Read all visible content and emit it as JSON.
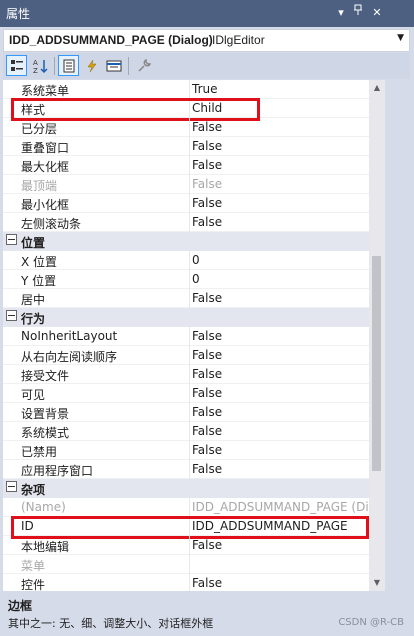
{
  "window": {
    "title": "属性"
  },
  "object_selector": {
    "name": "IDD_ADDSUMMAND_PAGE (Dialog)",
    "type": "IDlgEditor"
  },
  "toolbar": {
    "buttons": [
      "categorized-icon",
      "alphabetical-icon",
      "properties-icon",
      "events-icon",
      "messages-icon",
      "property-pages-icon"
    ]
  },
  "rows": [
    {
      "kind": "prop",
      "label": "系统菜单",
      "value": "True"
    },
    {
      "kind": "prop",
      "label": "样式",
      "value": "Child"
    },
    {
      "kind": "prop",
      "label": "已分层",
      "value": "False"
    },
    {
      "kind": "prop",
      "label": "重叠窗口",
      "value": "False"
    },
    {
      "kind": "prop",
      "label": "最大化框",
      "value": "False"
    },
    {
      "kind": "prop",
      "label": "最顶端",
      "value": "False",
      "disabled": true
    },
    {
      "kind": "prop",
      "label": "最小化框",
      "value": "False"
    },
    {
      "kind": "prop",
      "label": "左侧滚动条",
      "value": "False"
    },
    {
      "kind": "cat",
      "label": "位置"
    },
    {
      "kind": "prop",
      "label": "X 位置",
      "value": "0"
    },
    {
      "kind": "prop",
      "label": "Y 位置",
      "value": "0"
    },
    {
      "kind": "prop",
      "label": "居中",
      "value": "False"
    },
    {
      "kind": "cat",
      "label": "行为"
    },
    {
      "kind": "prop",
      "label": "NoInheritLayout",
      "value": "False"
    },
    {
      "kind": "prop",
      "label": "从右向左阅读顺序",
      "value": "False"
    },
    {
      "kind": "prop",
      "label": "接受文件",
      "value": "False"
    },
    {
      "kind": "prop",
      "label": "可见",
      "value": "False"
    },
    {
      "kind": "prop",
      "label": "设置背景",
      "value": "False"
    },
    {
      "kind": "prop",
      "label": "系统模式",
      "value": "False"
    },
    {
      "kind": "prop",
      "label": "已禁用",
      "value": "False"
    },
    {
      "kind": "prop",
      "label": "应用程序窗口",
      "value": "False"
    },
    {
      "kind": "cat",
      "label": "杂项"
    },
    {
      "kind": "prop",
      "label": "(Name)",
      "value": "IDD_ADDSUMMAND_PAGE (Di",
      "disabled": true
    },
    {
      "kind": "prop",
      "label": "ID",
      "value": "IDD_ADDSUMMAND_PAGE"
    },
    {
      "kind": "prop",
      "label": "本地编辑",
      "value": "False"
    },
    {
      "kind": "prop",
      "label": "菜单",
      "value": "",
      "disabled": true
    },
    {
      "kind": "prop",
      "label": "控件",
      "value": "False"
    }
  ],
  "description": {
    "title": "边框",
    "text": "其中之一: 无、细、调整大小、对话框外框"
  },
  "watermark": "CSDN @R-CB",
  "colors": {
    "titlebar": "#4d6082",
    "highlight": "#e0101b",
    "category": "#e3e6ee"
  }
}
